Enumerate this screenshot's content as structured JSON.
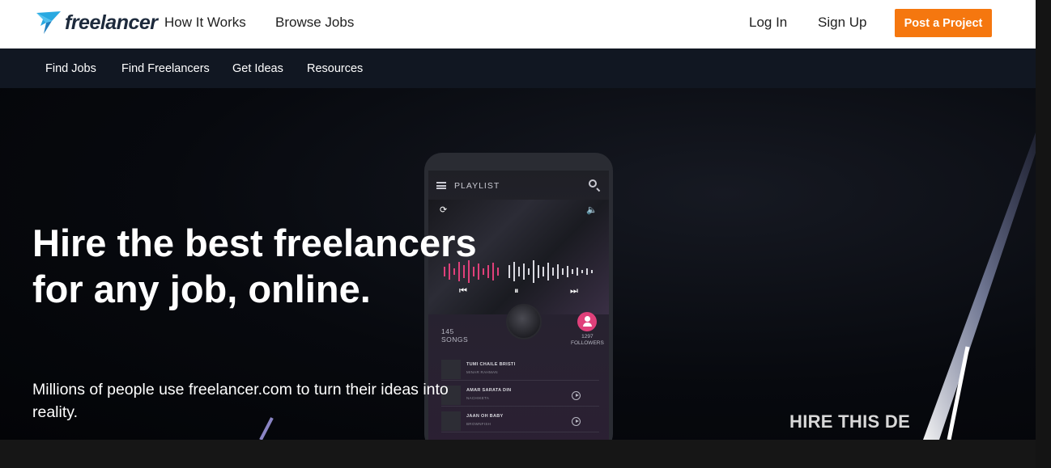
{
  "brand": {
    "logo_text": "freelancer",
    "accent": "#f5770f",
    "logo_blue": "#29a9e1"
  },
  "header": {
    "nav": [
      "How It Works",
      "Browse Jobs"
    ],
    "login": "Log In",
    "signup": "Sign Up",
    "cta": "Post a Project"
  },
  "subnav": {
    "items": [
      "Find Jobs",
      "Find Freelancers",
      "Get Ideas",
      "Resources"
    ]
  },
  "hero": {
    "headline": "Hire the best freelancers for any job, online.",
    "subhead": "Millions of people use freelancer.com to turn their ideas into reality.",
    "video_overlay_text": "HIRE THIS DE"
  },
  "phone": {
    "playlist_label": "PLAYLIST",
    "songs_count": "145",
    "songs_label": "SONGS",
    "followers_count": "1297",
    "followers_label": "FOLLOWERS",
    "tracks": [
      {
        "title": "TUMI CHAILE BRISTI",
        "artist": "MINAR RAHMAN"
      },
      {
        "title": "AMAR SARATA DIN",
        "artist": "NACHIKETA"
      },
      {
        "title": "JAAN OH BABY",
        "artist": "BROWNFISH"
      }
    ]
  }
}
